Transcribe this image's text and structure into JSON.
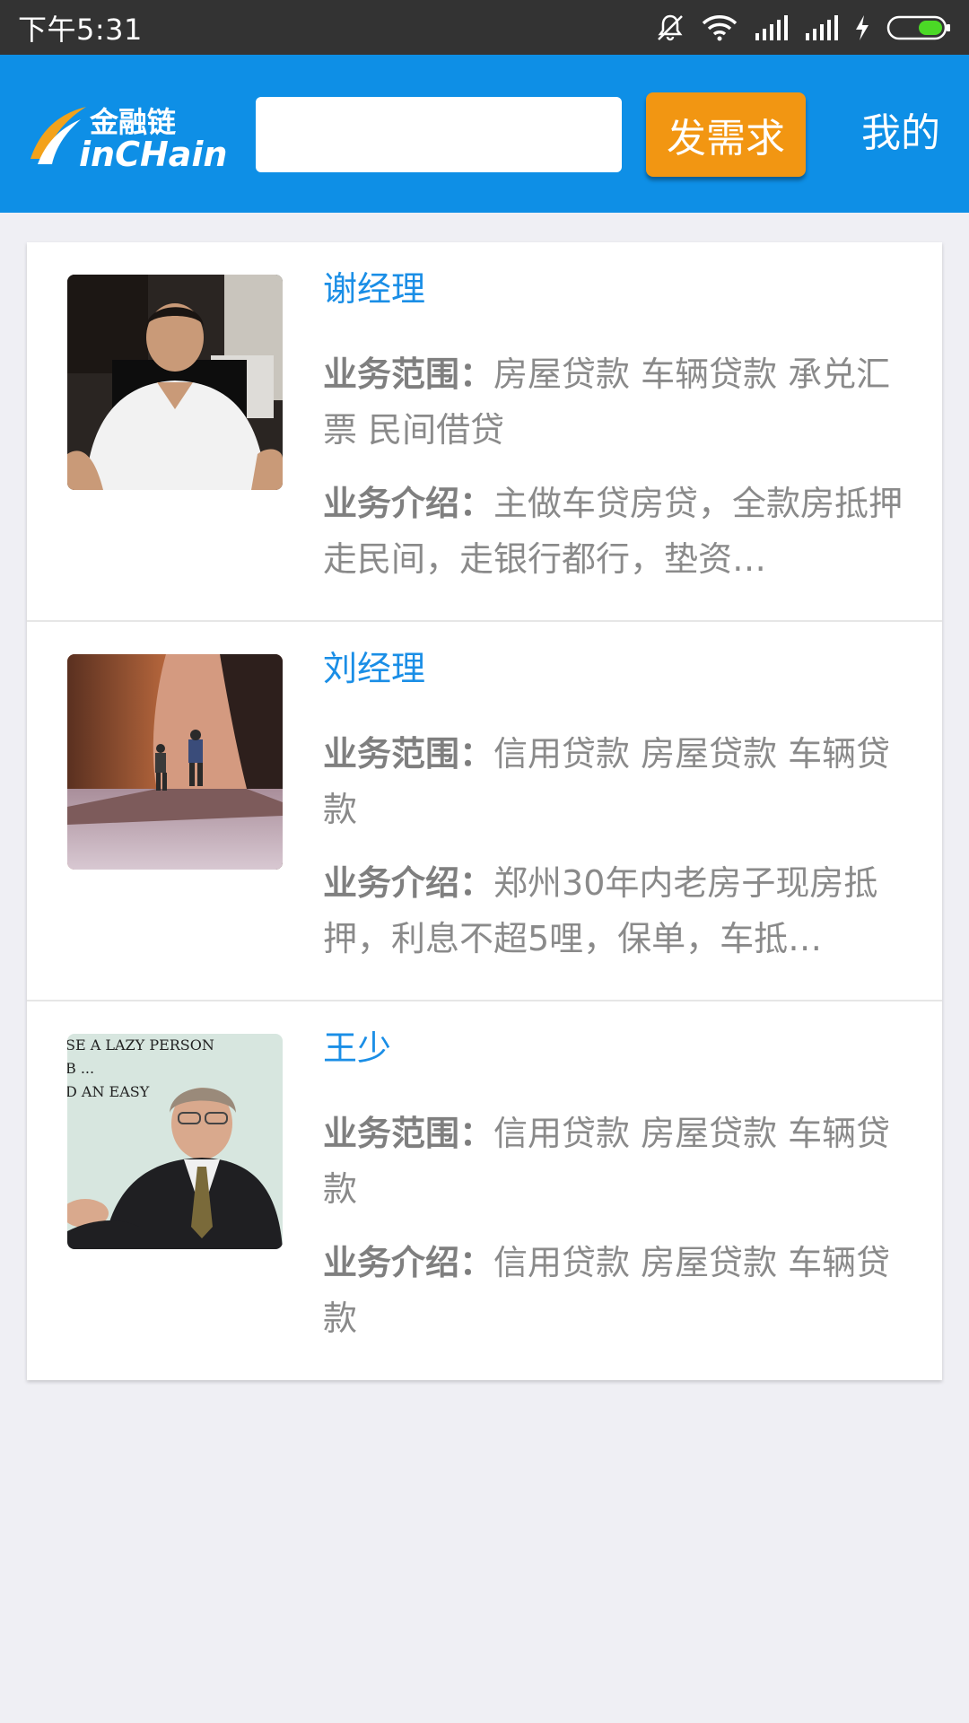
{
  "status_bar": {
    "time": "下午5:31"
  },
  "header": {
    "logo_cn": "金融链",
    "logo_en": "Finchain",
    "search": {
      "value": "",
      "placeholder": ""
    },
    "post_button": "发需求",
    "my_link": "我的",
    "colors": {
      "header_bg": "#0e8fe6",
      "button_bg": "#f29612"
    }
  },
  "managers": [
    {
      "name": "谢经理",
      "scope_label": "业务范围：",
      "scope": "房屋贷款 车辆贷款 承兑汇票 民间借贷",
      "intro_label": "业务介绍：",
      "intro": "主做车贷房贷，全款房抵押走民间，走银行都行，垫资…"
    },
    {
      "name": "刘经理",
      "scope_label": "业务范围：",
      "scope": "信用贷款 房屋贷款 车辆贷款",
      "intro_label": "业务介绍：",
      "intro": "郑州30年内老房子现房抵押，利息不超5哩，保单，车抵…"
    },
    {
      "name": "王少",
      "scope_label": "业务范围：",
      "scope": "信用贷款 房屋贷款 车辆贷款",
      "intro_label": "业务介绍：",
      "intro": "信用贷款 房屋贷款 车辆贷款",
      "avatar_caption_lines": [
        "SE A LAZY PERSON",
        "B ...",
        "D AN EASY"
      ]
    }
  ]
}
